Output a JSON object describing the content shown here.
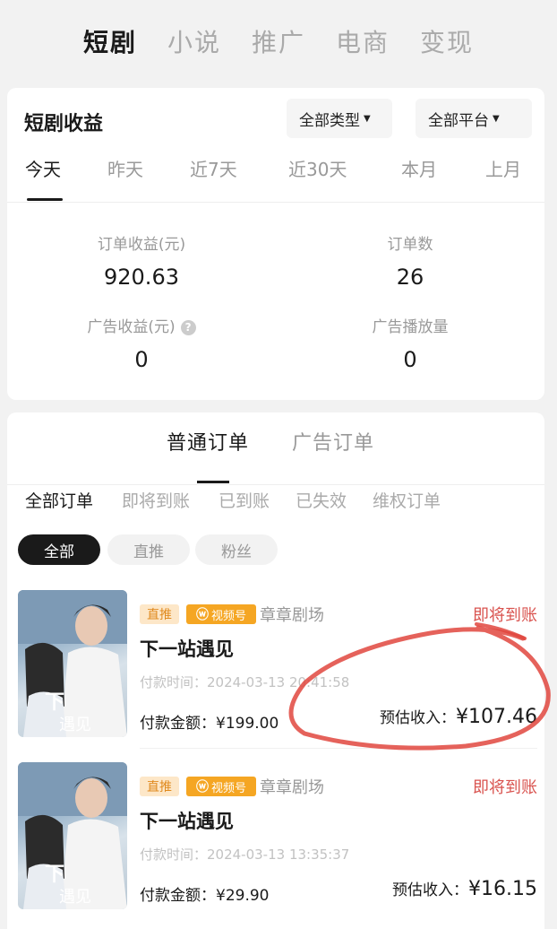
{
  "top_tabs": [
    {
      "label": "短剧",
      "active": true
    },
    {
      "label": "小说",
      "active": false
    },
    {
      "label": "推广",
      "active": false
    },
    {
      "label": "电商",
      "active": false
    },
    {
      "label": "变现",
      "active": false
    }
  ],
  "earnings": {
    "title": "短剧收益",
    "filter_type": "全部类型",
    "filter_platform": "全部平台",
    "periods": [
      "今天",
      "昨天",
      "近7天",
      "近30天",
      "本月",
      "上月"
    ],
    "active_period": "今天",
    "stats": {
      "order_income_label": "订单收益(元)",
      "order_income_value": "920.63",
      "order_count_label": "订单数",
      "order_count_value": "26",
      "ad_income_label": "广告收益(元)",
      "ad_income_value": "0",
      "ad_plays_label": "广告播放量",
      "ad_plays_value": "0"
    }
  },
  "orders": {
    "type_tabs": [
      "普通订单",
      "广告订单"
    ],
    "status_tabs": [
      "全部订单",
      "即将到账",
      "已到账",
      "已失效",
      "维权订单"
    ],
    "chips": [
      "全部",
      "直推",
      "粉丝"
    ],
    "items": [
      {
        "badge_direct": "直推",
        "badge_channel": "视频号",
        "shop": "章章剧场",
        "status": "即将到账",
        "title": "下一站遇见",
        "pay_time": "付款时间：2024-03-13 20:41:58",
        "pay_amount": "付款金额：¥199.00",
        "est_label": "预估收入：",
        "est_value": "¥107.46"
      },
      {
        "badge_direct": "直推",
        "badge_channel": "视频号",
        "shop": "章章剧场",
        "status": "即将到账",
        "title": "下一站遇见",
        "pay_time": "付款时间：2024-03-13 13:35:37",
        "pay_amount": "付款金额：¥29.90",
        "est_label": "预估收入：",
        "est_value": "¥16.15"
      }
    ]
  },
  "colors": {
    "status_red": "#d9534f",
    "badge_orange": "#f5a623",
    "annotation_red": "#e0473e"
  }
}
